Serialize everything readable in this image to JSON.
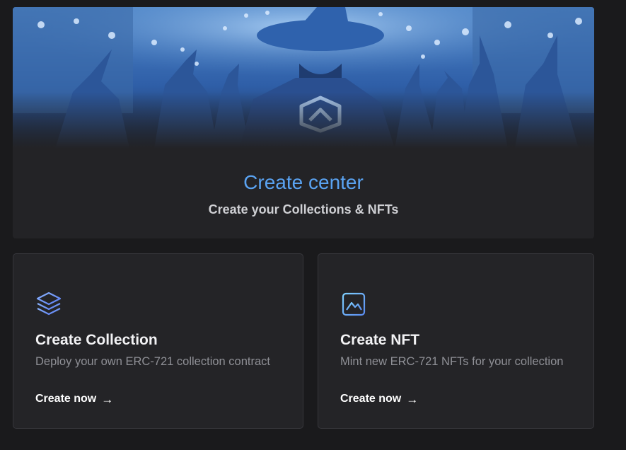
{
  "hero": {
    "title": "Create center",
    "subtitle": "Create your Collections & NFTs"
  },
  "cards": [
    {
      "title": "Create Collection",
      "description": "Deploy your own ERC-721 collection contract",
      "cta": "Create now",
      "icon": "layers-icon"
    },
    {
      "title": "Create NFT",
      "description": "Mint new ERC-721 NFTs for your collection",
      "cta": "Create now",
      "icon": "image-icon"
    }
  ],
  "colors": {
    "accent": "#5aa3f2",
    "background": "#1a1a1c",
    "card": "#242427"
  }
}
